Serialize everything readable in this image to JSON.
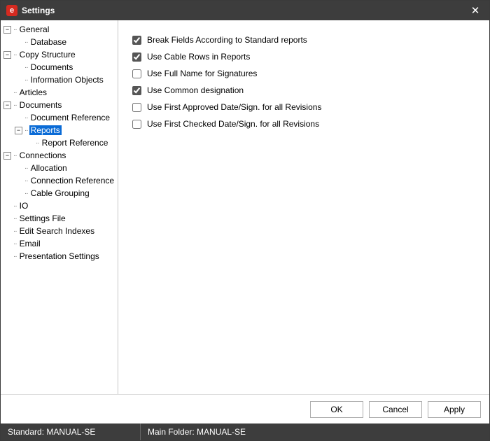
{
  "window": {
    "title": "Settings",
    "app_icon_letter": "e"
  },
  "tree": [
    {
      "label": "General",
      "toggle": "-",
      "depth": 0,
      "children": [
        {
          "label": "Database",
          "depth": 1
        }
      ]
    },
    {
      "label": "Copy Structure",
      "toggle": "-",
      "depth": 0,
      "children": [
        {
          "label": "Documents",
          "depth": 1
        },
        {
          "label": "Information Objects",
          "depth": 1
        }
      ]
    },
    {
      "label": "Articles",
      "depth": 0
    },
    {
      "label": "Documents",
      "toggle": "-",
      "depth": 0,
      "children": [
        {
          "label": "Document Reference",
          "depth": 1
        },
        {
          "label": "Reports",
          "toggle": "-",
          "depth": 1,
          "selected": true,
          "children": [
            {
              "label": "Report Reference",
              "depth": 2
            }
          ]
        }
      ]
    },
    {
      "label": "Connections",
      "toggle": "-",
      "depth": 0,
      "children": [
        {
          "label": "Allocation",
          "depth": 1
        },
        {
          "label": "Connection Reference",
          "depth": 1
        },
        {
          "label": "Cable Grouping",
          "depth": 1
        }
      ]
    },
    {
      "label": "IO",
      "depth": 0
    },
    {
      "label": "Settings File",
      "depth": 0
    },
    {
      "label": "Edit Search Indexes",
      "depth": 0
    },
    {
      "label": "Email",
      "depth": 0
    },
    {
      "label": "Presentation Settings",
      "depth": 0
    }
  ],
  "options": [
    {
      "key": "break_fields",
      "label": "Break Fields According to Standard reports",
      "checked": true
    },
    {
      "key": "cable_rows",
      "label": "Use Cable Rows in Reports",
      "checked": true
    },
    {
      "key": "full_name_sig",
      "label": "Use Full Name for Signatures",
      "checked": false
    },
    {
      "key": "common_desig",
      "label": "Use Common designation",
      "checked": true
    },
    {
      "key": "first_approved",
      "label": "Use First Approved Date/Sign. for all Revisions",
      "checked": false
    },
    {
      "key": "first_checked",
      "label": "Use First Checked Date/Sign. for all Revisions",
      "checked": false
    }
  ],
  "buttons": {
    "ok": "OK",
    "cancel": "Cancel",
    "apply": "Apply"
  },
  "status": {
    "standard": "Standard: MANUAL-SE",
    "main_folder": "Main Folder: MANUAL-SE"
  }
}
